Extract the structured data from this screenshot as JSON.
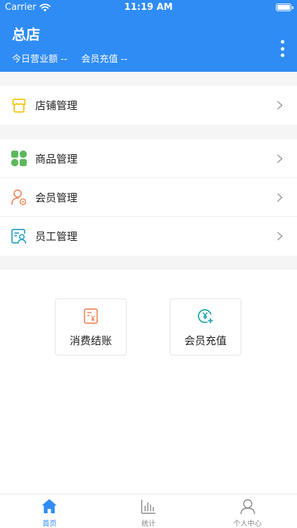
{
  "status_bar": {
    "carrier": "Carrier",
    "time": "11:19 AM"
  },
  "header": {
    "title": "总店",
    "today_revenue": "今日营业额 --",
    "member_recharge": "会员充值 --"
  },
  "menu_groups": [
    {
      "items": [
        {
          "label": "店铺管理",
          "icon": "store-icon"
        }
      ]
    },
    {
      "items": [
        {
          "label": "商品管理",
          "icon": "grid-icon"
        },
        {
          "label": "会员管理",
          "icon": "member-icon"
        },
        {
          "label": "员工管理",
          "icon": "staff-icon"
        }
      ]
    }
  ],
  "actions": [
    {
      "label": "消费结账",
      "icon": "receipt-icon"
    },
    {
      "label": "会员充值",
      "icon": "recharge-icon"
    }
  ],
  "tabbar": [
    {
      "label": "首页",
      "icon": "home-icon",
      "active": true
    },
    {
      "label": "统计",
      "icon": "stats-icon",
      "active": false
    },
    {
      "label": "个人中心",
      "icon": "user-icon",
      "active": false
    }
  ],
  "colors": {
    "primary": "#2f8cf5",
    "store_icon": "#f5c518",
    "grid_icon": "#5cb85c",
    "member_icon": "#f08a5d",
    "staff_icon": "#2aa3c6",
    "receipt_icon": "#f08a5d",
    "recharge_icon": "#17a2a2"
  }
}
